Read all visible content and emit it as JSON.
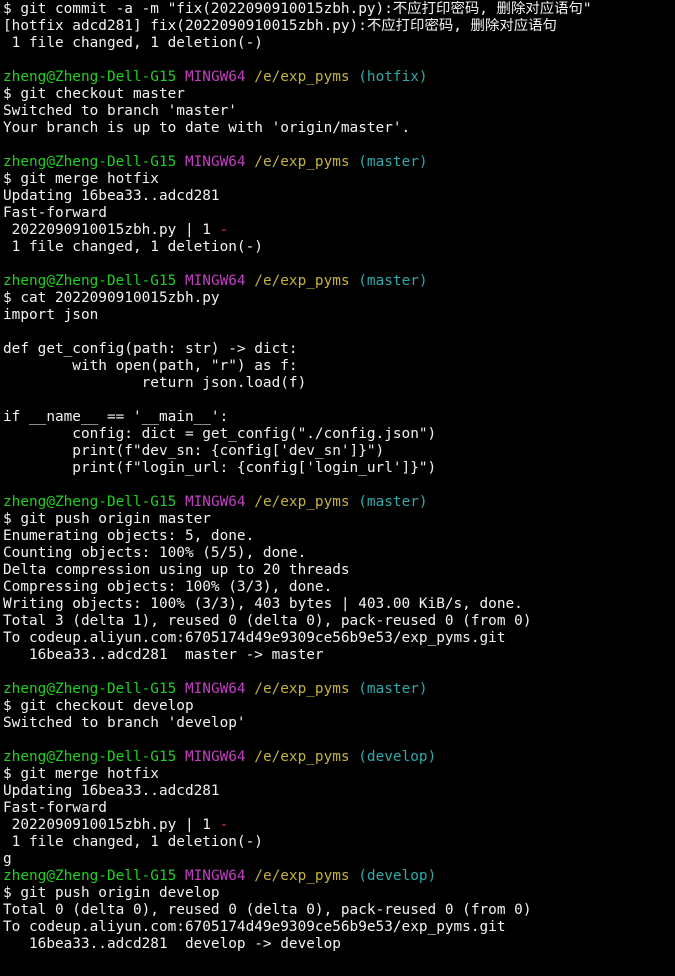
{
  "colors": {
    "background": "#000000",
    "text": "#f2f2f2",
    "prompt_user": "#1fd11f",
    "prompt_system": "#c33ec3",
    "prompt_path": "#c4b23b",
    "prompt_branch": "#2fa9a9",
    "diff_minus": "#d23c3c"
  },
  "lines": [
    {
      "type": "out",
      "text": "$ git commit -a -m \"fix(2022090910015zbh.py):不应打印密码, 删除对应语句\""
    },
    {
      "type": "out",
      "text": "[hotfix adcd281] fix(2022090910015zbh.py):不应打印密码, 删除对应语句"
    },
    {
      "type": "out",
      "text": " 1 file changed, 1 deletion(-)"
    },
    {
      "type": "blank"
    },
    {
      "type": "prompt",
      "user": "zheng@Zheng-Dell-G15",
      "system": "MINGW64",
      "path": "/e/exp_pyms",
      "branch": "(hotfix)"
    },
    {
      "type": "out",
      "text": "$ git checkout master"
    },
    {
      "type": "out",
      "text": "Switched to branch 'master'"
    },
    {
      "type": "out",
      "text": "Your branch is up to date with 'origin/master'."
    },
    {
      "type": "blank"
    },
    {
      "type": "prompt",
      "user": "zheng@Zheng-Dell-G15",
      "system": "MINGW64",
      "path": "/e/exp_pyms",
      "branch": "(master)"
    },
    {
      "type": "out",
      "text": "$ git merge hotfix"
    },
    {
      "type": "out",
      "text": "Updating 16bea33..adcd281"
    },
    {
      "type": "out",
      "text": "Fast-forward"
    },
    {
      "type": "diffstat",
      "text": " 2022090910015zbh.py | 1 ",
      "minus": "-"
    },
    {
      "type": "out",
      "text": " 1 file changed, 1 deletion(-)"
    },
    {
      "type": "blank"
    },
    {
      "type": "prompt",
      "user": "zheng@Zheng-Dell-G15",
      "system": "MINGW64",
      "path": "/e/exp_pyms",
      "branch": "(master)"
    },
    {
      "type": "out",
      "text": "$ cat 2022090910015zbh.py"
    },
    {
      "type": "out",
      "text": "import json"
    },
    {
      "type": "blank"
    },
    {
      "type": "out",
      "text": "def get_config(path: str) -> dict:"
    },
    {
      "type": "out",
      "text": "        with open(path, \"r\") as f:"
    },
    {
      "type": "out",
      "text": "                return json.load(f)"
    },
    {
      "type": "blank"
    },
    {
      "type": "out",
      "text": "if __name__ == '__main__':"
    },
    {
      "type": "out",
      "text": "        config: dict = get_config(\"./config.json\")"
    },
    {
      "type": "out",
      "text": "        print(f\"dev_sn: {config['dev_sn']}\")"
    },
    {
      "type": "out",
      "text": "        print(f\"login_url: {config['login_url']}\")"
    },
    {
      "type": "blank"
    },
    {
      "type": "prompt",
      "user": "zheng@Zheng-Dell-G15",
      "system": "MINGW64",
      "path": "/e/exp_pyms",
      "branch": "(master)"
    },
    {
      "type": "out",
      "text": "$ git push origin master"
    },
    {
      "type": "out",
      "text": "Enumerating objects: 5, done."
    },
    {
      "type": "out",
      "text": "Counting objects: 100% (5/5), done."
    },
    {
      "type": "out",
      "text": "Delta compression using up to 20 threads"
    },
    {
      "type": "out",
      "text": "Compressing objects: 100% (3/3), done."
    },
    {
      "type": "out",
      "text": "Writing objects: 100% (3/3), 403 bytes | 403.00 KiB/s, done."
    },
    {
      "type": "out",
      "text": "Total 3 (delta 1), reused 0 (delta 0), pack-reused 0 (from 0)"
    },
    {
      "type": "out",
      "text": "To codeup.aliyun.com:6705174d49e9309ce56b9e53/exp_pyms.git"
    },
    {
      "type": "out",
      "text": "   16bea33..adcd281  master -> master"
    },
    {
      "type": "blank"
    },
    {
      "type": "prompt",
      "user": "zheng@Zheng-Dell-G15",
      "system": "MINGW64",
      "path": "/e/exp_pyms",
      "branch": "(master)"
    },
    {
      "type": "out",
      "text": "$ git checkout develop"
    },
    {
      "type": "out",
      "text": "Switched to branch 'develop'"
    },
    {
      "type": "blank"
    },
    {
      "type": "prompt",
      "user": "zheng@Zheng-Dell-G15",
      "system": "MINGW64",
      "path": "/e/exp_pyms",
      "branch": "(develop)"
    },
    {
      "type": "out",
      "text": "$ git merge hotfix"
    },
    {
      "type": "out",
      "text": "Updating 16bea33..adcd281"
    },
    {
      "type": "out",
      "text": "Fast-forward"
    },
    {
      "type": "diffstat",
      "text": " 2022090910015zbh.py | 1 ",
      "minus": "-"
    },
    {
      "type": "out",
      "text": " 1 file changed, 1 deletion(-)"
    },
    {
      "type": "out",
      "text": "g"
    },
    {
      "type": "prompt",
      "user": "zheng@Zheng-Dell-G15",
      "system": "MINGW64",
      "path": "/e/exp_pyms",
      "branch": "(develop)"
    },
    {
      "type": "out",
      "text": "$ git push origin develop"
    },
    {
      "type": "out",
      "text": "Total 0 (delta 0), reused 0 (delta 0), pack-reused 0 (from 0)"
    },
    {
      "type": "out",
      "text": "To codeup.aliyun.com:6705174d49e9309ce56b9e53/exp_pyms.git"
    },
    {
      "type": "out",
      "text": "   16bea33..adcd281  develop -> develop"
    }
  ]
}
